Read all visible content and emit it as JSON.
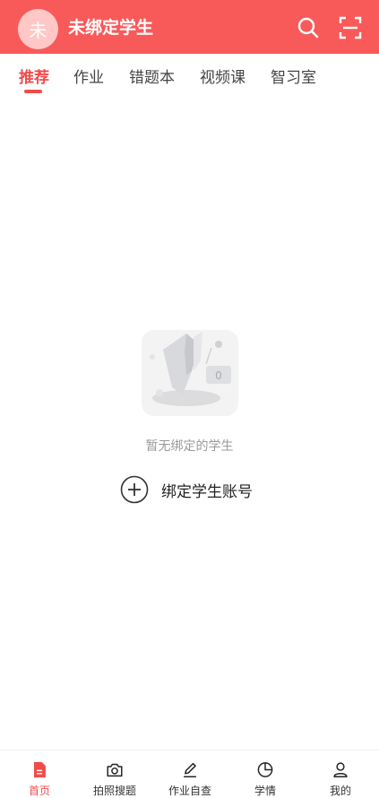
{
  "header": {
    "avatar_char": "未",
    "title": "未绑定学生",
    "icons": [
      "search-icon",
      "scan-icon"
    ]
  },
  "tabs": [
    {
      "label": "推荐",
      "active": true
    },
    {
      "label": "作业"
    },
    {
      "label": "错题本"
    },
    {
      "label": "视频课"
    },
    {
      "label": "智习室"
    }
  ],
  "empty_state": {
    "badge": "0",
    "message": "暂无绑定的学生",
    "bind_label": "绑定学生账号"
  },
  "bottom_nav": [
    {
      "label": "首页",
      "icon": "document-icon",
      "active": true
    },
    {
      "label": "拍照搜题",
      "icon": "camera-icon"
    },
    {
      "label": "作业自查",
      "icon": "edit-icon"
    },
    {
      "label": "学情",
      "icon": "pie-chart-icon"
    },
    {
      "label": "我的",
      "icon": "user-icon"
    }
  ],
  "colors": {
    "brand": "#f85a5a",
    "accent": "#f24b4b",
    "muted_text": "#9a9a9a"
  }
}
